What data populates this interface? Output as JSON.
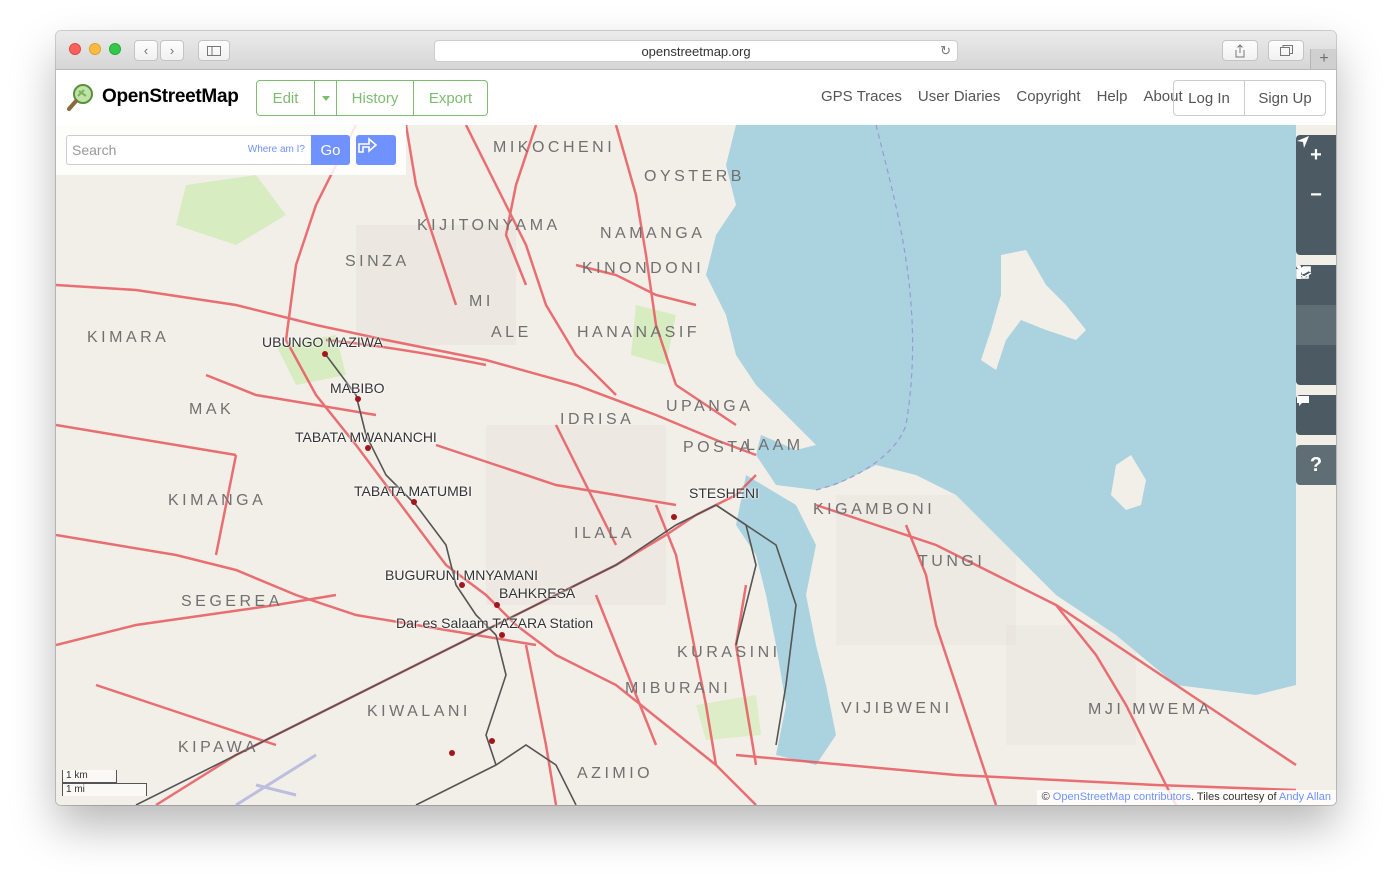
{
  "browser": {
    "url": "openstreetmap.org"
  },
  "header": {
    "logo_text": "OpenStreetMap",
    "edit_label": "Edit",
    "history_label": "History",
    "export_label": "Export",
    "nav": [
      "GPS Traces",
      "User Diaries",
      "Copyright",
      "Help",
      "About"
    ],
    "login_label": "Log In",
    "signup_label": "Sign Up",
    "accent_color": "#7ebc6f"
  },
  "search": {
    "placeholder": "Search",
    "where_am_i": "Where am I?",
    "go_label": "Go"
  },
  "map_controls": {
    "icons": [
      "zoom-in-icon",
      "zoom-out-icon",
      "locate-icon",
      "layers-icon",
      "info-icon",
      "share-icon",
      "note-icon",
      "help-icon"
    ],
    "help_label": "?"
  },
  "map": {
    "places": [
      "MIKOCHENI",
      "OYSTERB",
      "KIJITONYAMA",
      "NAMANGA",
      "SINZA",
      "KINONDONI",
      "MI",
      "KIMARA",
      "ALE",
      "HANANASIF",
      "MAK",
      "IDRISA",
      "UPANGA",
      "POSTA",
      "LAAM",
      "KIMANGA",
      "KIGAMBONI",
      "ILALA",
      "TUNGI",
      "SEGEREA",
      "KURASINI",
      "MIBURANI",
      "VIJIBWENI",
      "MJI MWEMA",
      "KIWALANI",
      "KIPAWA",
      "AZIMIO"
    ],
    "stations": [
      "UBUNGO MAZIWA",
      "MABIBO",
      "TABATA MWANANCHI",
      "TABATA MATUMBI",
      "STESHENI",
      "BUGURUNI MNYAMANI",
      "BAHKRESA",
      "Dar es Salaam TAZARA Station"
    ],
    "scale_km": "1 km",
    "scale_mi": "1 mi",
    "attribution_prefix": "©",
    "attribution_osm": "OpenStreetMap contributors",
    "attribution_mid": ". Tiles courtesy of",
    "attribution_author": "Andy Allan"
  }
}
